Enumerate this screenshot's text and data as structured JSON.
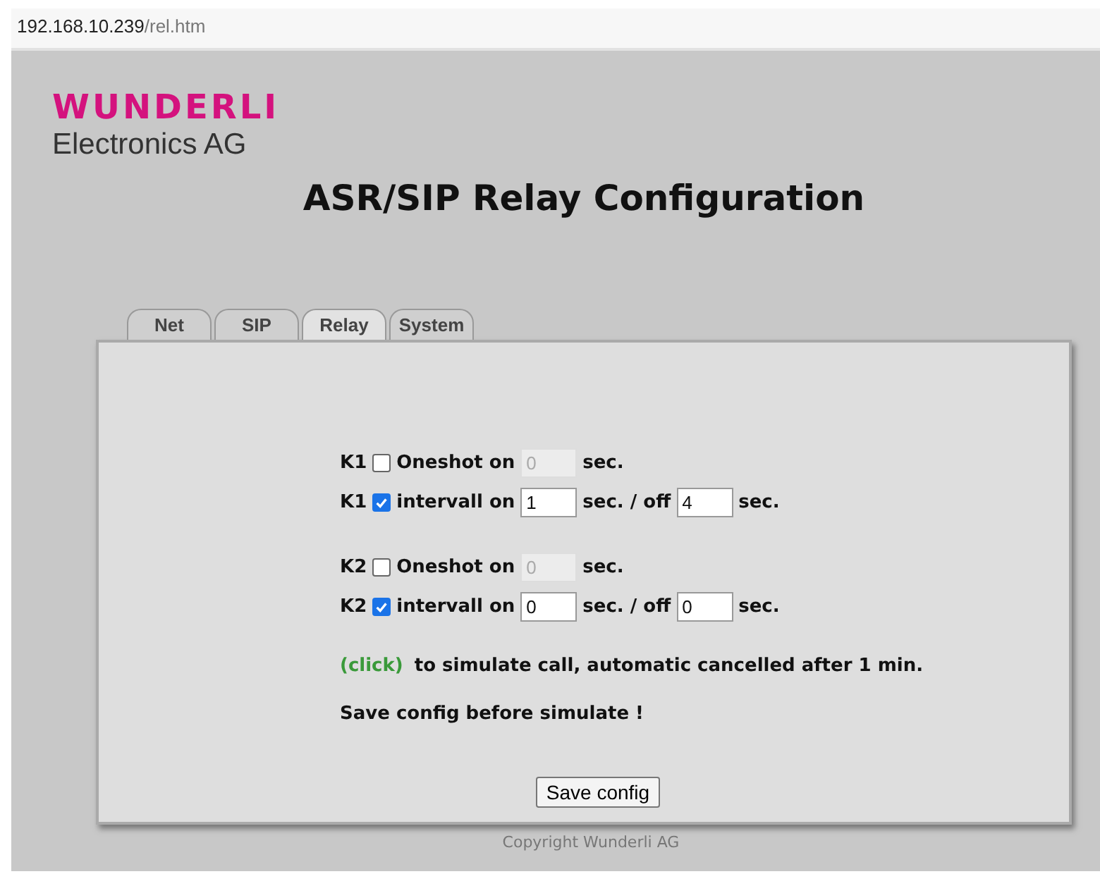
{
  "address_bar": {
    "host": "192.168.10.239",
    "path": "/rel.htm"
  },
  "logo": {
    "brand": "WUNDERLI",
    "subtitle": "Electronics AG"
  },
  "title": "ASR/SIP Relay Configuration",
  "tabs": [
    {
      "label": "Net",
      "selected": false
    },
    {
      "label": "SIP",
      "selected": false
    },
    {
      "label": "Relay",
      "selected": true
    },
    {
      "label": "System",
      "selected": false
    }
  ],
  "relays": [
    {
      "kind": "oneshot",
      "relay": "K1",
      "checked": false,
      "label": "Oneshot on",
      "value": "0",
      "disabled": true,
      "unit": "sec."
    },
    {
      "kind": "interval",
      "relay": "K1",
      "checked": true,
      "label": "intervall on",
      "value": "1",
      "unit": "sec. / off",
      "off_value": "4",
      "off_unit": "sec."
    },
    {
      "kind": "oneshot",
      "relay": "K2",
      "checked": false,
      "label": "Oneshot on",
      "value": "0",
      "disabled": true,
      "unit": "sec."
    },
    {
      "kind": "interval",
      "relay": "K2",
      "checked": true,
      "label": "intervall on",
      "value": "0",
      "unit": "sec. / off",
      "off_value": "0",
      "off_unit": "sec."
    }
  ],
  "simulate": {
    "link": "(click)",
    "text": "to simulate call, automatic cancelled after 1 min."
  },
  "note": "Save config before simulate !",
  "save_button": "Save config",
  "footer": "Copyright Wunderli AG"
}
